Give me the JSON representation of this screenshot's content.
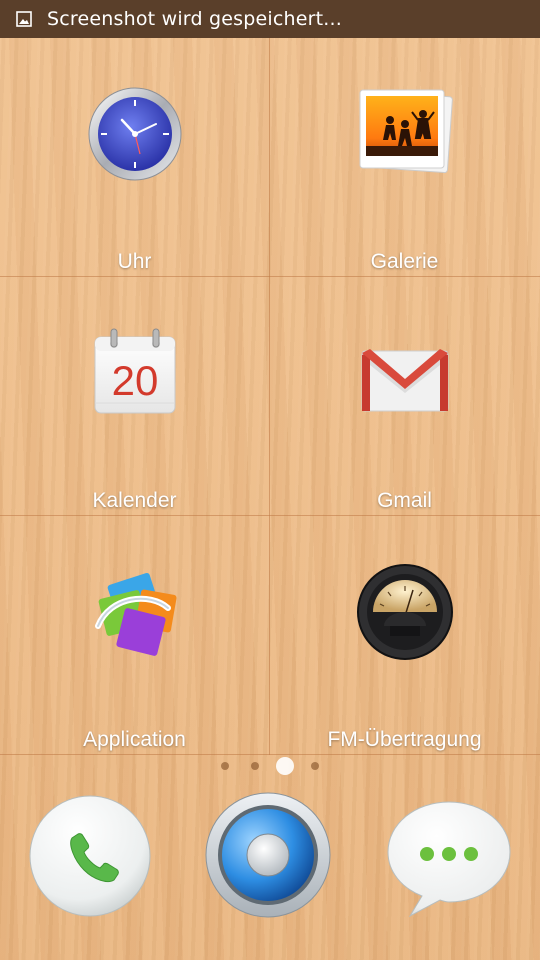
{
  "status_bar": {
    "notification_text": "Screenshot wird gespeichert..."
  },
  "apps": [
    {
      "label": "Uhr",
      "icon": "clock-icon"
    },
    {
      "label": "Galerie",
      "icon": "gallery-icon"
    },
    {
      "label": "Kalender",
      "icon": "calendar-icon",
      "icon_text": "20"
    },
    {
      "label": "Gmail",
      "icon": "gmail-icon"
    },
    {
      "label": "Application",
      "icon": "application-icon"
    },
    {
      "label": "FM-Übertragung",
      "icon": "fm-transmitter-icon"
    }
  ],
  "page_indicator": {
    "pages": 4,
    "current": 3
  },
  "dock": [
    {
      "icon": "phone-icon"
    },
    {
      "icon": "camera-icon"
    },
    {
      "icon": "messaging-icon"
    }
  ]
}
